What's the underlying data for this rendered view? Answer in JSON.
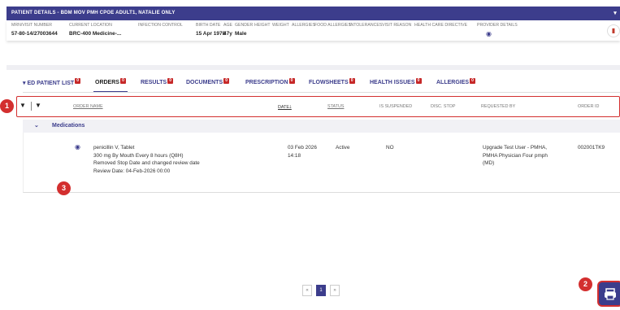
{
  "header": {
    "title": "PATIENT DETAILS - BDM MOV PMH CPOE ADULT1, NATALIE ONLY"
  },
  "patient_info": {
    "labels": [
      "MRN/VISIT NUMBER",
      "CURRENT LOCATION",
      "INFECTION CONTROL",
      "BIRTH DATE",
      "AGE",
      "GENDER",
      "HEIGHT",
      "WEIGHT",
      "ALLERGIES",
      "FOOD ALLERGIES",
      "INTOLERANCES",
      "VISIT REASON",
      "HEALTH CARE DIRECTIVE",
      "PROVIDER DETAILS"
    ],
    "mrn": "57-80-14/27003644",
    "location": "BRC-400 Medicine-...",
    "birth_date": "15 Apr 1978",
    "age": "47y",
    "gender": "Male"
  },
  "tabs": [
    {
      "label": "ED PATIENT LIST",
      "badge": "0",
      "prefix": "▾"
    },
    {
      "label": "ORDERS",
      "badge": "0",
      "active": true
    },
    {
      "label": "RESULTS",
      "badge": "0"
    },
    {
      "label": "DOCUMENTS",
      "badge": "0"
    },
    {
      "label": "PRESCRIPTION",
      "badge": "0"
    },
    {
      "label": "FLOWSHEETS",
      "badge": "0"
    },
    {
      "label": "HEALTH ISSUES",
      "badge": "0"
    },
    {
      "label": "ALLERGIES",
      "badge": "0"
    }
  ],
  "table": {
    "columns": {
      "order_name": "ORDER NAME",
      "date": "DATE",
      "date_sort": "🡓",
      "status": "STATUS",
      "is_suspended": "IS SUSPENDED",
      "disc_stop": "DISC. STOP",
      "requested_by": "REQUESTED BY",
      "order_id": "ORDER ID"
    },
    "group": "Medications",
    "row": {
      "name_lines": [
        "penicillin V, Tablet",
        "300 mg By Mouth Every 8 hours (Q8H)",
        "Removed Stop Date and changed review date",
        "Review Date: 04-Feb-2026 00:00"
      ],
      "date_lines": [
        "03 Feb 2026",
        "14:18"
      ],
      "status": "Active",
      "is_suspended": "NO",
      "requested_lines": [
        "Upgrade Test User - PMHA,",
        "PMHA Physician Four pmph",
        "(MD)"
      ],
      "order_id": "002001TK9"
    }
  },
  "markers": [
    "1",
    "2",
    "3"
  ],
  "pagination": {
    "prev": "«",
    "current": "1",
    "next": "»"
  }
}
